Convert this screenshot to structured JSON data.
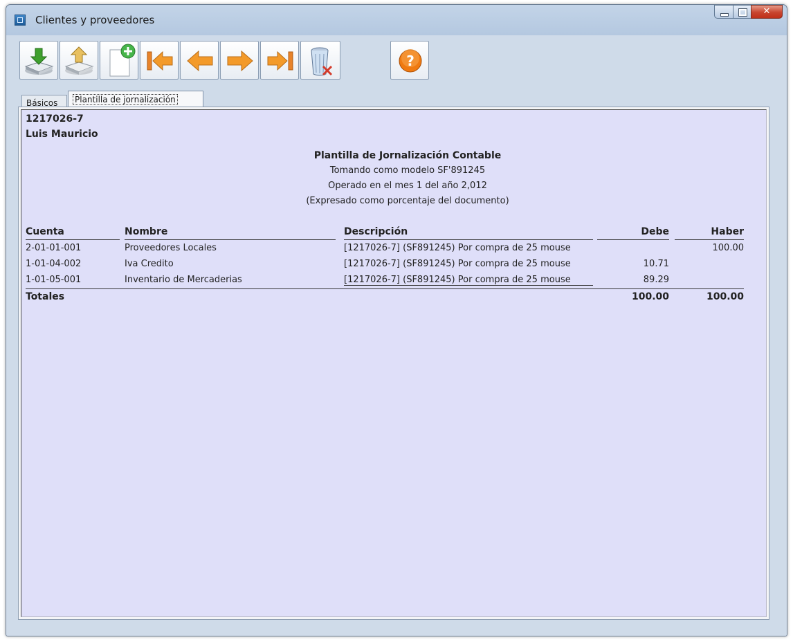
{
  "window": {
    "title": "Clientes y proveedores"
  },
  "toolbar": {
    "buttons": [
      {
        "id": "save",
        "icon": "save-tray-icon"
      },
      {
        "id": "load",
        "icon": "load-tray-icon"
      },
      {
        "id": "new",
        "icon": "new-document-icon"
      },
      {
        "id": "first",
        "icon": "first-record-icon"
      },
      {
        "id": "prev",
        "icon": "previous-arrow-icon"
      },
      {
        "id": "next",
        "icon": "next-arrow-icon"
      },
      {
        "id": "last",
        "icon": "last-record-icon"
      },
      {
        "id": "delete",
        "icon": "trash-delete-icon"
      },
      {
        "id": "help",
        "icon": "help-icon"
      }
    ]
  },
  "tabs": [
    {
      "label": "Básicos",
      "active": false
    },
    {
      "label": "Plantilla de jornalización",
      "active": true
    }
  ],
  "report": {
    "code": "1217026-7",
    "name": "Luis Mauricio",
    "title": "Plantilla de Jornalización Contable",
    "subtitle1": "Tomando como modelo SF'891245",
    "subtitle2": "Operado en el mes 1 del año 2,012",
    "subtitle3": "(Expresado como porcentaje del documento)",
    "columns": {
      "cuenta": "Cuenta",
      "nombre": "Nombre",
      "descripcion": "Descripción",
      "debe": "Debe",
      "haber": "Haber"
    },
    "rows": [
      {
        "cuenta": "2-01-01-001",
        "nombre": "Proveedores Locales",
        "descripcion": "[1217026-7] (SF891245) Por compra de 25 mouse",
        "debe": "",
        "haber": "100.00"
      },
      {
        "cuenta": "1-01-04-002",
        "nombre": "Iva Credito",
        "descripcion": "[1217026-7] (SF891245) Por compra de 25 mouse",
        "debe": "10.71",
        "haber": ""
      },
      {
        "cuenta": "1-01-05-001",
        "nombre": "Inventario de Mercaderias",
        "descripcion": "[1217026-7] (SF891245) Por compra de 25 mouse",
        "debe": "89.29",
        "haber": ""
      }
    ],
    "totals": {
      "label": "Totales",
      "debe": "100.00",
      "haber": "100.00"
    }
  },
  "colors": {
    "report_bg": "#dfdff9",
    "accent_orange": "#f39a2a",
    "help_orange": "#f07a10"
  }
}
